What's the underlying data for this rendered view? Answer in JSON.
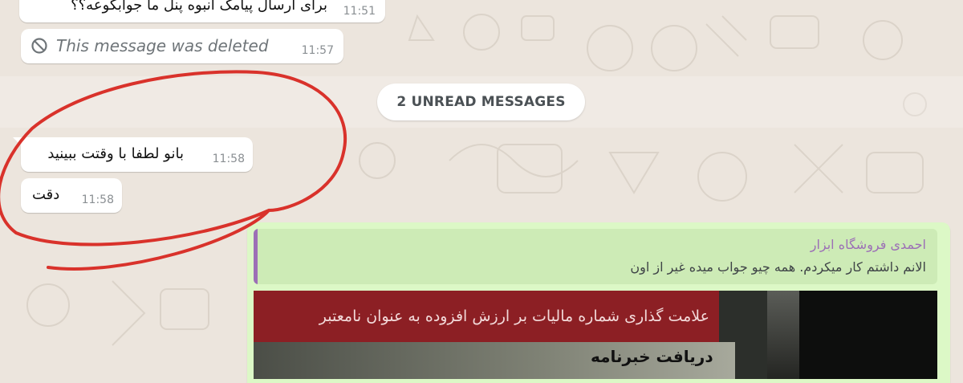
{
  "chat": {
    "messages": [
      {
        "text": "برای ارسال پیامک انبوه پنل ما جوابگوعه؟؟",
        "time": "11:51"
      },
      {
        "text": "This message was deleted",
        "time": "11:57",
        "deleted": true
      }
    ],
    "unread_divider": "2 UNREAD MESSAGES",
    "unread_messages": [
      {
        "text": "بانو لطفا با وقتت ببینید",
        "time": "11:58"
      },
      {
        "text": "دقت",
        "time": "11:58"
      }
    ],
    "reply": {
      "quoted_sender": "احمدی فروشگاه ابزار",
      "quoted_text": "الانم داشتم کار میکردم. همه چیو جواب میده غیر از اون",
      "photo_caption_red": "علامت گذاری شماره مالیات بر ارزش افزوده به عنوان نامعتبر",
      "photo_caption_paper": "دریافت خبرنامه"
    }
  },
  "colors": {
    "chat_background": "#ece5dd",
    "incoming_bubble": "#ffffff",
    "outgoing_bubble": "#dcf8c6",
    "quote_accent": "#9c6fb6",
    "annotation_red": "#d9322b"
  },
  "icons": {
    "deleted": "block-icon"
  }
}
